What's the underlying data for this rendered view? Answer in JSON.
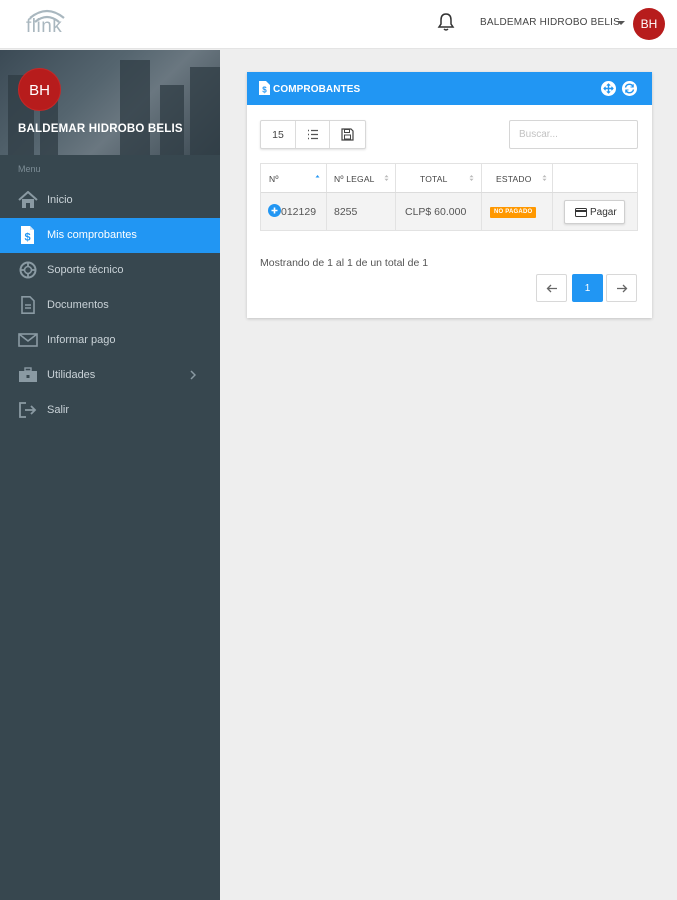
{
  "app": {
    "logo_text": "flink"
  },
  "header": {
    "user_name": "BALDEMAR HIDROBO BELIS",
    "avatar_initials": "BH"
  },
  "sidebar": {
    "avatar_initials": "BH",
    "user_name": "BALDEMAR HIDROBO BELIS",
    "menu_label": "Menu",
    "items": [
      {
        "label": "Inicio",
        "icon": "home-icon"
      },
      {
        "label": "Mis comprobantes",
        "icon": "document-dollar-icon",
        "active": true
      },
      {
        "label": "Soporte técnico",
        "icon": "lifebuoy-icon"
      },
      {
        "label": "Documentos",
        "icon": "file-icon"
      },
      {
        "label": "Informar pago",
        "icon": "envelope-icon"
      },
      {
        "label": "Utilidades",
        "icon": "toolbox-icon",
        "has_submenu": true
      },
      {
        "label": "Salir",
        "icon": "logout-icon"
      }
    ]
  },
  "card": {
    "title": "COMPROBANTES",
    "page_size": "15",
    "search_placeholder": "Buscar...",
    "columns": [
      "Nº",
      "Nº LEGAL",
      "TOTAL",
      "ESTADO"
    ],
    "rows": [
      {
        "numero": "012129",
        "legal": "8255",
        "total": "CLP$ 60.000",
        "estado": "NO PAGADO",
        "action": "Pagar"
      }
    ],
    "info": "Mostrando de 1 al 1 de un total de 1",
    "current_page": "1"
  },
  "colors": {
    "primary": "#2196f3",
    "sidebar": "#37474f",
    "avatar": "#b71c1c",
    "warning": "#ff9800"
  }
}
